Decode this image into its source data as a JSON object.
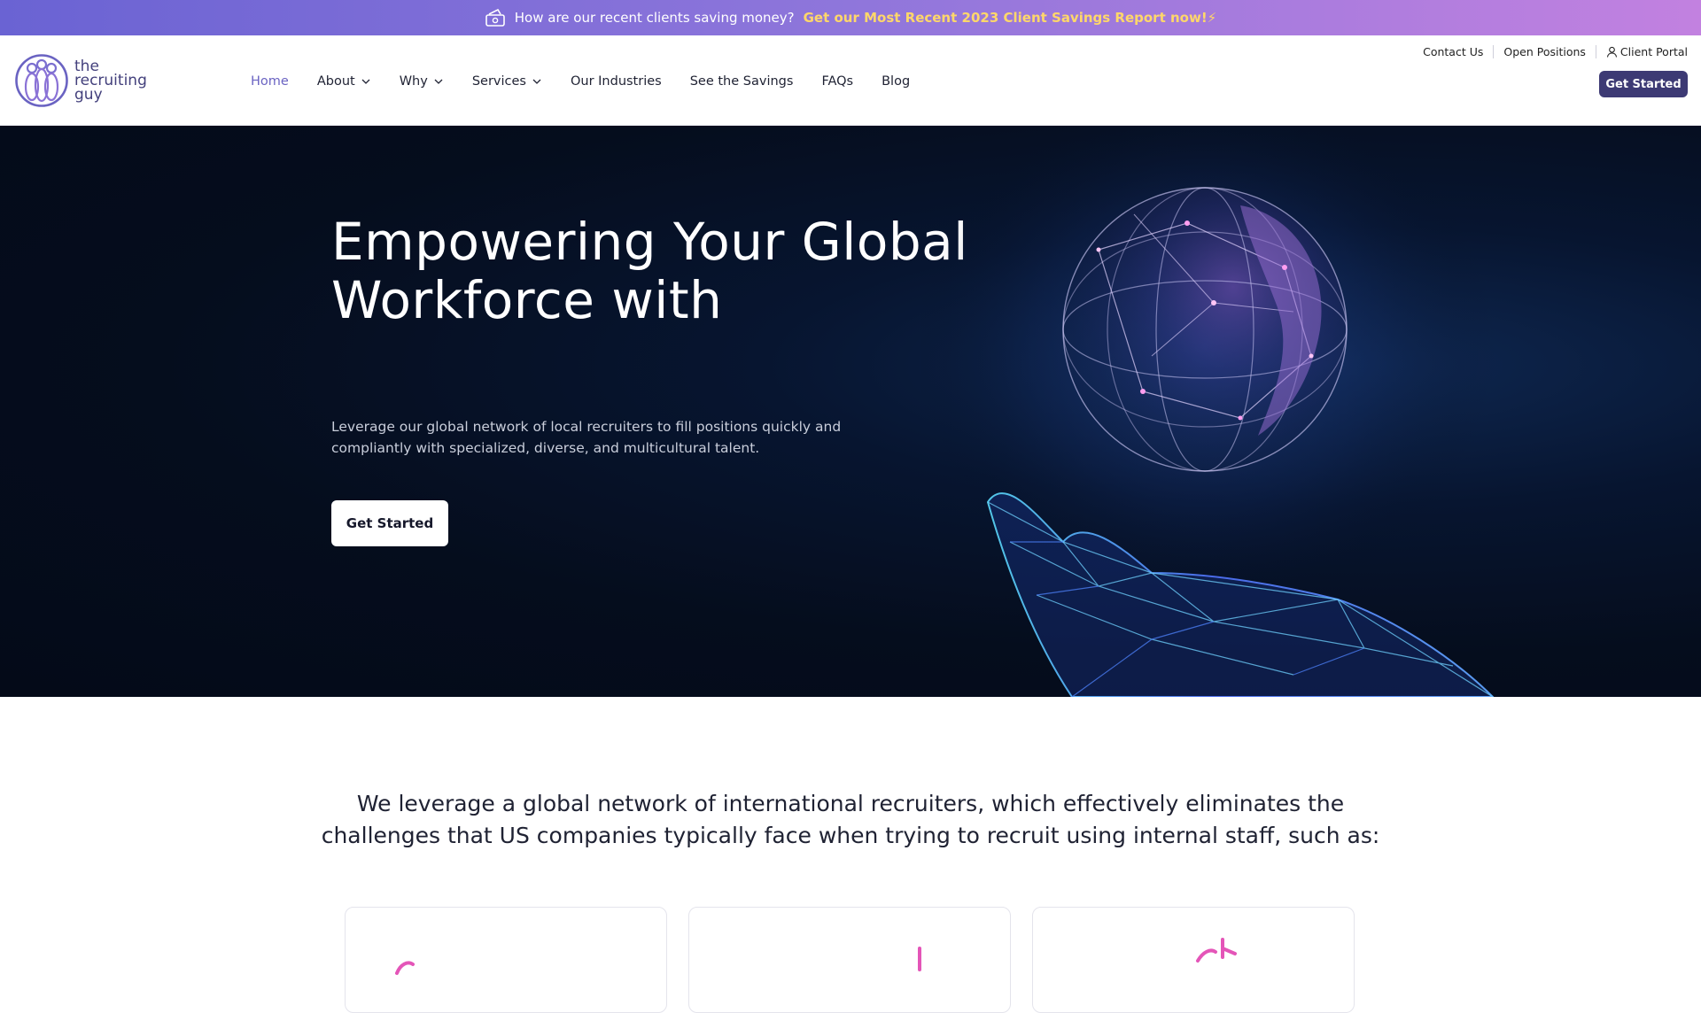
{
  "announcement": {
    "text": "How are our recent clients saving money?",
    "link": "Get our Most Recent 2023 Client Savings Report now!⚡",
    "icon": "money-icon"
  },
  "brand": {
    "logo_text": [
      "the",
      "recruiting",
      "guy"
    ],
    "accent": "#6a63c2",
    "button_dark": "#3d3a74"
  },
  "nav": [
    {
      "label": "Home",
      "active": true,
      "dropdown": false
    },
    {
      "label": "About",
      "active": false,
      "dropdown": true
    },
    {
      "label": "Why",
      "active": false,
      "dropdown": true
    },
    {
      "label": "Services",
      "active": false,
      "dropdown": true
    },
    {
      "label": "Our Industries",
      "active": false,
      "dropdown": false
    },
    {
      "label": "See the Savings",
      "active": false,
      "dropdown": false
    },
    {
      "label": "FAQs",
      "active": false,
      "dropdown": false
    },
    {
      "label": "Blog",
      "active": false,
      "dropdown": false
    }
  ],
  "utility": {
    "contact": "Contact Us",
    "positions": "Open Positions",
    "portal": "Client Portal"
  },
  "header_cta": "Get Started",
  "hero": {
    "title": "Empowering Your Global Workforce with",
    "subtitle": "Leverage our global network of local recruiters to fill positions quickly and compliantly with specialized, diverse, and multicultural talent.",
    "button": "Get Started"
  },
  "intro": {
    "text": "We leverage a global network of international recruiters, which effectively eliminates the challenges that US companies typically face when trying to recruit using internal staff, such as:"
  }
}
